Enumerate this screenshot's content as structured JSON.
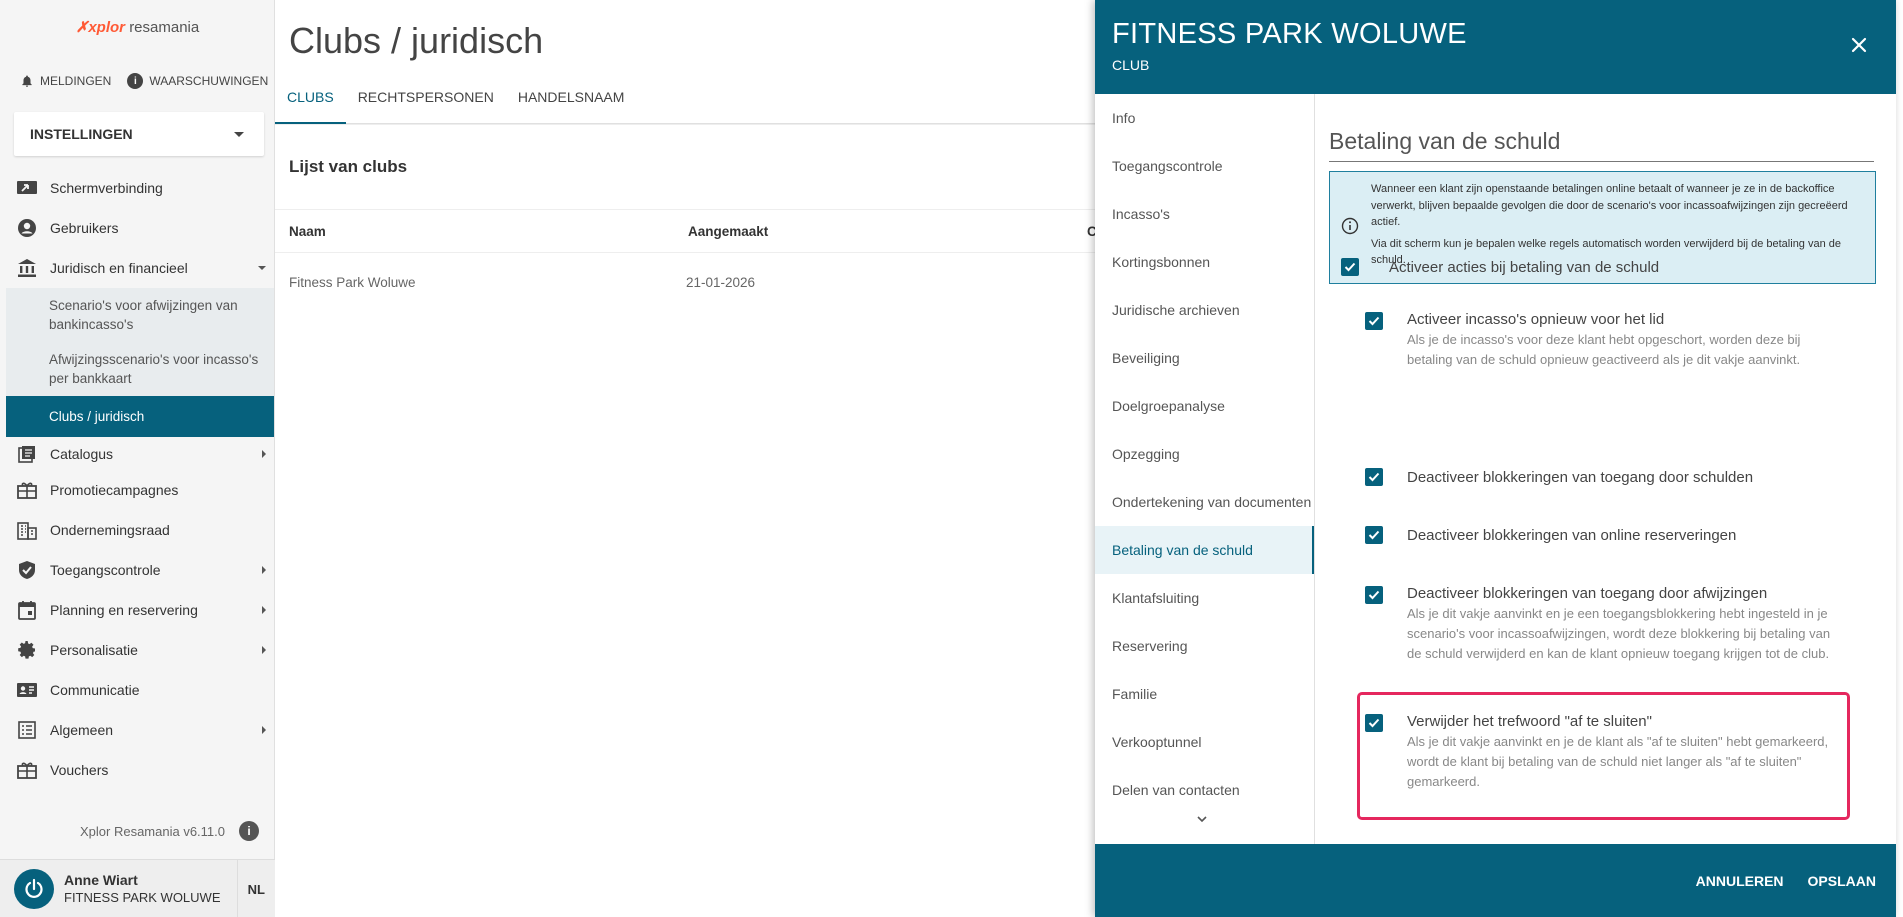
{
  "sidebar": {
    "logo_mark": "✗xplor",
    "logo_text": "resamania",
    "notifications_label": "MELDINGEN",
    "warnings_label": "WAARSCHUWINGEN",
    "settings_select": "INSTELLINGEN",
    "items": [
      {
        "label": "Schermverbinding",
        "icon": "screen-share-icon"
      },
      {
        "label": "Gebruikers",
        "icon": "account-circle-icon"
      },
      {
        "label": "Juridisch en financieel",
        "icon": "bank-icon"
      },
      {
        "label": "Catalogus",
        "icon": "catalog-icon"
      },
      {
        "label": "Promotiecampagnes",
        "icon": "gift-icon"
      },
      {
        "label": "Ondernemingsraad",
        "icon": "building-icon"
      },
      {
        "label": "Toegangscontrole",
        "icon": "shield-check-icon"
      },
      {
        "label": "Planning en reservering",
        "icon": "calendar-icon"
      },
      {
        "label": "Personalisatie",
        "icon": "gear-icon"
      },
      {
        "label": "Communicatie",
        "icon": "contact-card-icon"
      },
      {
        "label": "Algemeen",
        "icon": "list-icon"
      },
      {
        "label": "Vouchers",
        "icon": "gift-icon"
      }
    ],
    "sub_items": [
      {
        "label": "Scenario's voor afwijzingen van bankincasso's"
      },
      {
        "label": "Afwijzingsscenario's voor incasso's per bankkaart"
      },
      {
        "label": "Clubs / juridisch"
      }
    ],
    "version": "Xplor Resamania v6.11.0",
    "user_name": "Anne Wiart",
    "user_club": "FITNESS PARK WOLUWE",
    "language": "NL"
  },
  "main": {
    "title": "Clubs / juridisch",
    "tabs": [
      {
        "label": "CLUBS"
      },
      {
        "label": "RECHTSPERSONEN"
      },
      {
        "label": "HANDELSNAAM"
      }
    ],
    "list_title": "Lijst van clubs",
    "columns": [
      "Naam",
      "Aangemaakt",
      "C"
    ],
    "rows": [
      {
        "name": "Fitness Park Woluwe",
        "created": "21-01-2026"
      }
    ]
  },
  "drawer": {
    "title": "FITNESS PARK WOLUWE",
    "subtitle": "CLUB",
    "nav": [
      {
        "label": "Info"
      },
      {
        "label": "Toegangscontrole"
      },
      {
        "label": "Incasso's"
      },
      {
        "label": "Kortingsbonnen"
      },
      {
        "label": "Juridische archieven"
      },
      {
        "label": "Beveiliging"
      },
      {
        "label": "Doelgroepanalyse"
      },
      {
        "label": "Opzegging"
      },
      {
        "label": "Ondertekening van documenten"
      },
      {
        "label": "Betaling van de schuld"
      },
      {
        "label": "Klantafsluiting"
      },
      {
        "label": "Reservering"
      },
      {
        "label": "Familie"
      },
      {
        "label": "Verkooptunnel"
      },
      {
        "label": "Delen van contacten"
      }
    ],
    "section_title": "Betaling van de schuld",
    "info_p1": "Wanneer een klant zijn openstaande betalingen online betaalt of wanneer je ze in de backoffice verwerkt, blijven bepaalde gevolgen die door de scenario's voor incassoafwijzingen zijn gecreëerd actief.",
    "info_p2": "Via dit scherm kun je bepalen welke regels automatisch worden verwijderd bij de betaling van de schuld.",
    "options": [
      {
        "label": "Activeer acties bij betaling van de schuld",
        "desc": "",
        "checked": true
      },
      {
        "label": "Activeer incasso's opnieuw voor het lid",
        "desc": "Als je de incasso's voor deze klant hebt opgeschort, worden deze bij betaling van de schuld opnieuw geactiveerd als je dit vakje aanvinkt.",
        "checked": true
      },
      {
        "label": "Deactiveer blokkeringen van toegang door schulden",
        "desc": "",
        "checked": true
      },
      {
        "label": "Deactiveer blokkeringen van online reserveringen",
        "desc": "",
        "checked": true
      },
      {
        "label": "Deactiveer blokkeringen van toegang door afwijzingen",
        "desc": "Als je dit vakje aanvinkt en je een toegangsblokkering hebt ingesteld in je scenario's voor incassoafwijzingen, wordt deze blokkering bij betaling van de schuld verwijderd en kan de klant opnieuw toegang krijgen tot de club.",
        "checked": true
      },
      {
        "label": "Verwijder het trefwoord \"af te sluiten\"",
        "desc": "Als je dit vakje aanvinkt en je de klant als \"af te sluiten\" hebt gemarkeerd, wordt de klant bij betaling van de schuld niet langer als \"af te sluiten\" gemarkeerd.",
        "checked": true
      }
    ],
    "cancel_label": "ANNULEREN",
    "save_label": "OPSLAAN"
  },
  "colors": {
    "primary": "#06617d",
    "info_bg": "#dbeef4",
    "highlight": "#e5275e",
    "logo_accent": "#ff5a36"
  }
}
